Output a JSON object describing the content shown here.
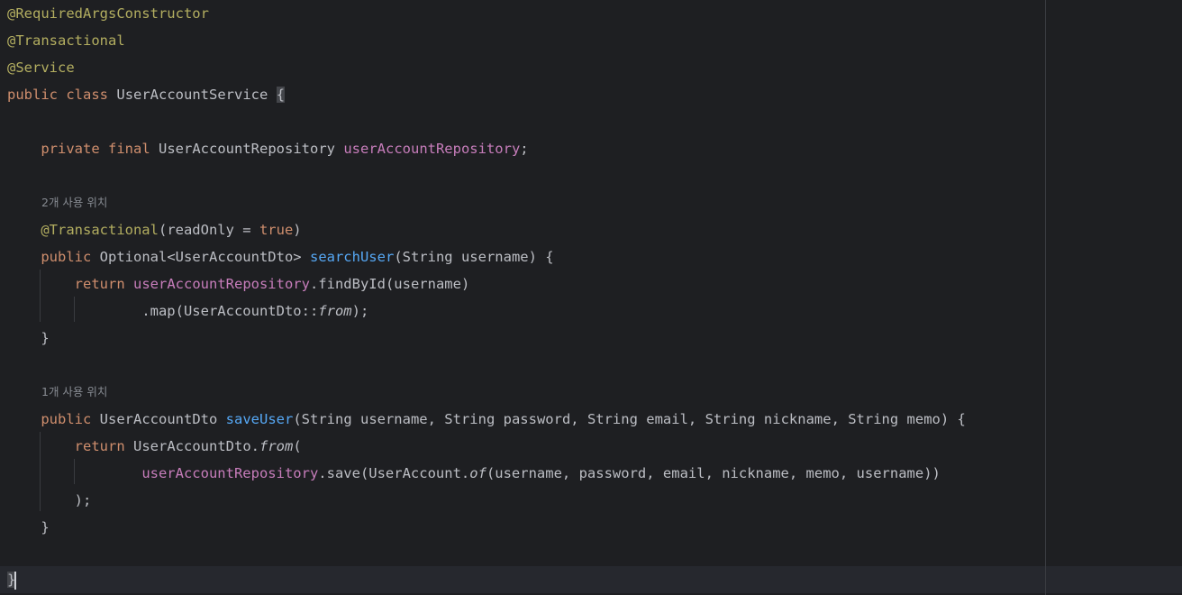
{
  "editor": {
    "language": "java",
    "colors": {
      "background": "#1e1f22",
      "text": "#bcbec4",
      "annotation": "#b3ae60",
      "keyword": "#cf8e6d",
      "field": "#c77dbb",
      "method_declaration": "#56a8f5",
      "inlay_hint": "#868a91"
    },
    "code": {
      "l1": {
        "ann": "@RequiredArgsConstructor"
      },
      "l2": {
        "ann": "@Transactional"
      },
      "l3": {
        "ann": "@Service"
      },
      "l4": {
        "kw1": "public",
        "kw2": "class",
        "name": "UserAccountService",
        "brace": "{"
      },
      "l6": {
        "kw1": "private",
        "kw2": "final",
        "type": "UserAccountRepository",
        "field": "userAccountRepository",
        "end": ";"
      },
      "hint1": "2개 사용 위치",
      "l8": {
        "ann": "@Transactional",
        "rest": "(readOnly = ",
        "kw": "true",
        "close": ")"
      },
      "l9": {
        "kw": "public",
        "type": "Optional<UserAccountDto>",
        "method": "searchUser",
        "params": "(String username) {"
      },
      "l10": {
        "kw": "return",
        "field": "userAccountRepository",
        "rest": ".findById(username)"
      },
      "l11": {
        "pre": ".map(UserAccountDto::",
        "ital": "from",
        "post": ");"
      },
      "l12": {
        "text": "}"
      },
      "hint2": "1개 사용 위치",
      "l15": {
        "kw": "public",
        "type": "UserAccountDto",
        "method": "saveUser",
        "params": "(String username, String password, String email, String nickname, String memo) {"
      },
      "l16": {
        "kw": "return",
        "pre": "UserAccountDto.",
        "ital": "from",
        "post": "("
      },
      "l17": {
        "field": "userAccountRepository",
        "pre": ".save(UserAccount.",
        "ital": "of",
        "post": "(username, password, email, nickname, memo, username))"
      },
      "l18": {
        "text": ");"
      },
      "l19": {
        "text": "}"
      },
      "l21": {
        "text": "}"
      }
    }
  }
}
